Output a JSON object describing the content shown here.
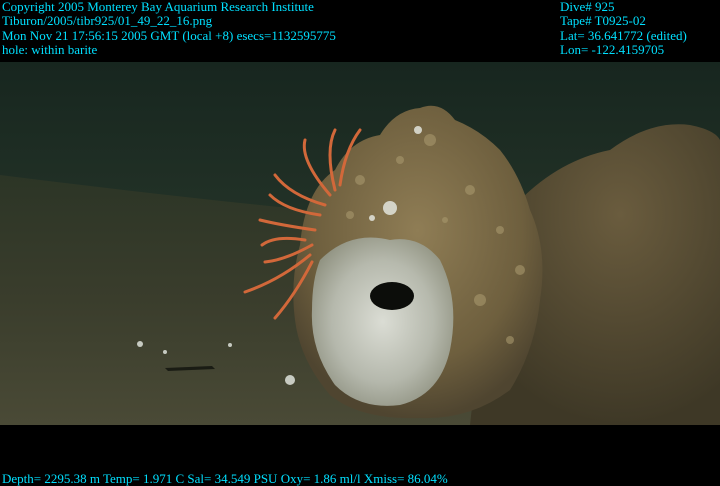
{
  "overlay": {
    "color": "#00e0ff",
    "header_left": [
      "Copyright 2005 Monterey Bay Aquarium Research Institute",
      "Tiburon/2005/tibr925/01_49_22_16.png",
      "Mon Nov 21 17:56:15 2005 GMT (local +8)  esecs=1132595775",
      "hole: within barite"
    ],
    "header_right": [
      "Dive# 925",
      "Tape# T0925-02",
      "Lat= 36.641772 (edited)",
      "Lon= -122.4159705"
    ],
    "footer": "Depth= 2295.38 m  Temp= 1.971 C  Sal= 34.549 PSU  Oxy= 1.86 ml/l  Xmiss= 86.04%"
  },
  "colors": {
    "letterbox": "#000000",
    "water": "#1b2a22",
    "seafloor": "#3c3f2c",
    "rock": "#7a6a44",
    "barite": "#c9ccc4",
    "starfish": "#d2683a"
  }
}
